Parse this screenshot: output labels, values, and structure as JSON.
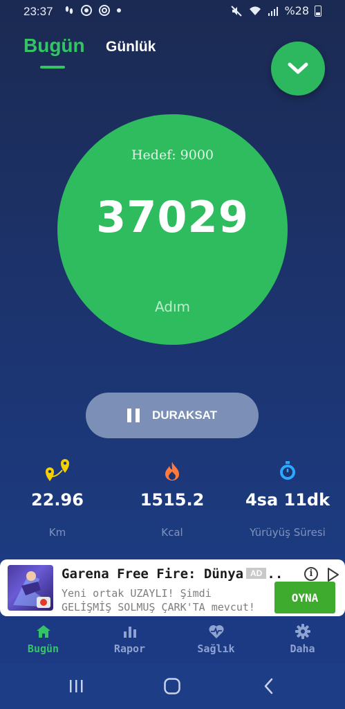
{
  "status_bar": {
    "time": "23:37",
    "battery": "%28"
  },
  "tabs": {
    "today": "Bugün",
    "daily": "Günlük"
  },
  "steps": {
    "goal": "Hedef: 9000",
    "count": "37029",
    "unit": "Adım"
  },
  "pause_button": {
    "label": "DURAKSAT"
  },
  "stats": [
    {
      "value": "22.96",
      "label": "Km",
      "icon": "route-pin-icon",
      "color": "#f5d000"
    },
    {
      "value": "1515.2",
      "label": "Kcal",
      "icon": "flame-icon",
      "color": "#ff7a3c"
    },
    {
      "value": "4sa 11dk",
      "label": "Yürüyüş Süresi",
      "icon": "stopwatch-icon",
      "color": "#2aa9ff"
    }
  ],
  "ad": {
    "title": "Garena Free Fire: Dünya S...",
    "badge": "AD",
    "description": "Yeni ortak UZAYLI! Şimdi GELİŞMİŞ SOLMUŞ ÇARK'TA mevcut!",
    "cta": "OYNA"
  },
  "bottom_nav": [
    {
      "label": "Bugün",
      "icon": "home-icon",
      "active": true
    },
    {
      "label": "Rapor",
      "icon": "bar-chart-icon",
      "active": false
    },
    {
      "label": "Sağlık",
      "icon": "heart-pulse-icon",
      "active": false
    },
    {
      "label": "Daha",
      "icon": "gear-icon",
      "active": false
    }
  ],
  "colors": {
    "accent": "#34c466",
    "inactive_nav": "#8ea3cf",
    "background_top": "#1b2a52",
    "background_bottom": "#1d3f8a"
  }
}
